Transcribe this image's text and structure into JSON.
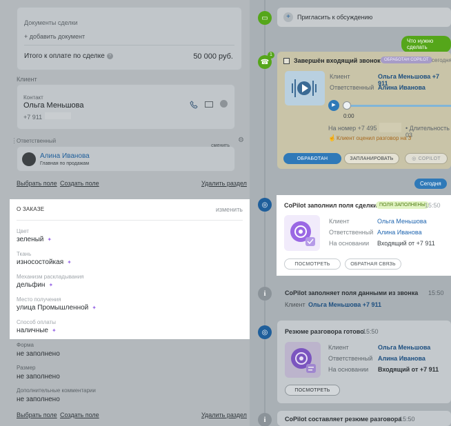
{
  "deal": {
    "documents_label": "Документы сделки",
    "add_document": "+ добавить документ",
    "total_label": "Итого к оплате по сделке",
    "total_value": "50 000 руб."
  },
  "client": {
    "section_label": "Клиент",
    "contact_label": "Контакт",
    "contact_name": "Ольга Меньшова",
    "contact_phone": "+7 911"
  },
  "responsible": {
    "section_label": "Ответственный",
    "change": "сменить",
    "name": "Алина Иванова",
    "role": "Главная по продажам"
  },
  "field_links": {
    "choose_field": "Выбрать поле",
    "create_field": "Создать поле",
    "delete_section": "Удалить раздел"
  },
  "order": {
    "header": "О ЗАКАЗЕ",
    "edit": "изменить",
    "fields": [
      {
        "label": "Цвет",
        "value": "зеленый"
      },
      {
        "label": "Ткань",
        "value": "износостойкая"
      },
      {
        "label": "Механизм раскладывания",
        "value": "дельфин"
      },
      {
        "label": "Место получения",
        "value": "улица Промышленной"
      },
      {
        "label": "Способ оплаты",
        "value": "наличные"
      }
    ]
  },
  "extra_fields": [
    {
      "label": "Форма",
      "value": "не заполнено"
    },
    {
      "label": "Размер",
      "value": "не заполнено"
    },
    {
      "label": "Дополнительные комментарии",
      "value": "не заполнено"
    }
  ],
  "timeline": {
    "invite": "Пригласить к обсуждению",
    "todo_pill": "Что нужно сделать",
    "call": {
      "title": "Завершён входящий звонок",
      "badge": "ОБРАБОТАН COPILOT",
      "time": "сегодня",
      "client_label": "Клиент",
      "client_value": "Ольга Меньшова +7 911",
      "resp_label": "Ответственный",
      "resp_value": "Алина Иванова",
      "number_label": "На номер +7 495",
      "duration": "• Длительность 03",
      "rating": "Клиент оценил разговор на 3",
      "btn_done": "ОБРАБОТАН",
      "btn_plan": "ЗАПЛАНИРОВАТЬ",
      "btn_copilot": "COPILOT",
      "badge_count": "1"
    },
    "today_pill": "Сегодня",
    "copilot_card": {
      "title": "CoPilot заполнил поля сделки",
      "badge": "ПОЛЯ ЗАПОЛНЕНЫ",
      "time": "15:50",
      "rows": [
        {
          "label": "Клиент",
          "value": "Ольга Меньшова"
        },
        {
          "label": "Ответственный",
          "value": "Алина Иванова"
        },
        {
          "label": "На основании",
          "value": "Входящий от +7 911"
        }
      ],
      "btn_view": "ПОСМОТРЕТЬ",
      "btn_feedback": "ОБРАТНАЯ СВЯЗЬ"
    },
    "filling": {
      "title": "CoPilot заполняет поля данными из звонка",
      "time": "15:50",
      "client_label": "Клиент",
      "client_value": "Ольга Меньшова +7 911"
    },
    "summary": {
      "title": "Резюме разговора готово",
      "time": "15:50",
      "rows": [
        {
          "label": "Клиент",
          "value": "Ольга Меньшова"
        },
        {
          "label": "Ответственный",
          "value": "Алина Иванова"
        },
        {
          "label": "На основании",
          "value": "Входящий от +7 911"
        }
      ],
      "btn_view": "ПОСМОТРЕТЬ"
    },
    "composing": {
      "title": "CoPilot составляет резюме разговора",
      "time": "15:50"
    }
  },
  "colors": {
    "green": "#55a61a",
    "blue": "#2fa4e7",
    "dark_blue": "#1f5f9b",
    "purple": "#8e5be0"
  }
}
